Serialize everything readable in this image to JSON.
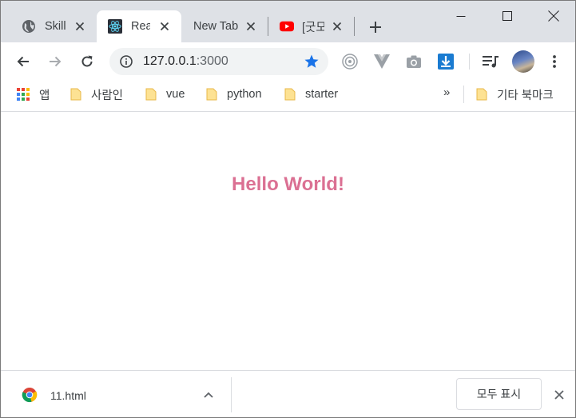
{
  "browser": {
    "tabs": [
      {
        "title": "Skill",
        "icon": "globe-icon"
      },
      {
        "title": "Rea",
        "icon": "react-icon",
        "active": true
      },
      {
        "title": "New Tab",
        "icon": ""
      },
      {
        "title": "[굿모",
        "icon": "youtube-icon"
      }
    ],
    "address": {
      "host": "127.0.0.1",
      "port": ":3000"
    },
    "bookmarks": [
      {
        "label": "앱",
        "icon": "apps-grid-icon"
      },
      {
        "label": "사람인",
        "icon": "folder-icon"
      },
      {
        "label": "vue",
        "icon": "folder-icon"
      },
      {
        "label": "python",
        "icon": "folder-icon"
      },
      {
        "label": "starter",
        "icon": "folder-icon"
      }
    ],
    "bookmarks_overflow": "»",
    "other_bookmarks": "기타 북마크"
  },
  "page": {
    "heading": "Hello World!"
  },
  "downloads": {
    "file_name": "11.html",
    "show_all_label": "모두 표시"
  },
  "colors": {
    "tabstrip": "#dee1e6",
    "heading": "#db7093",
    "star": "#1a73e8"
  }
}
